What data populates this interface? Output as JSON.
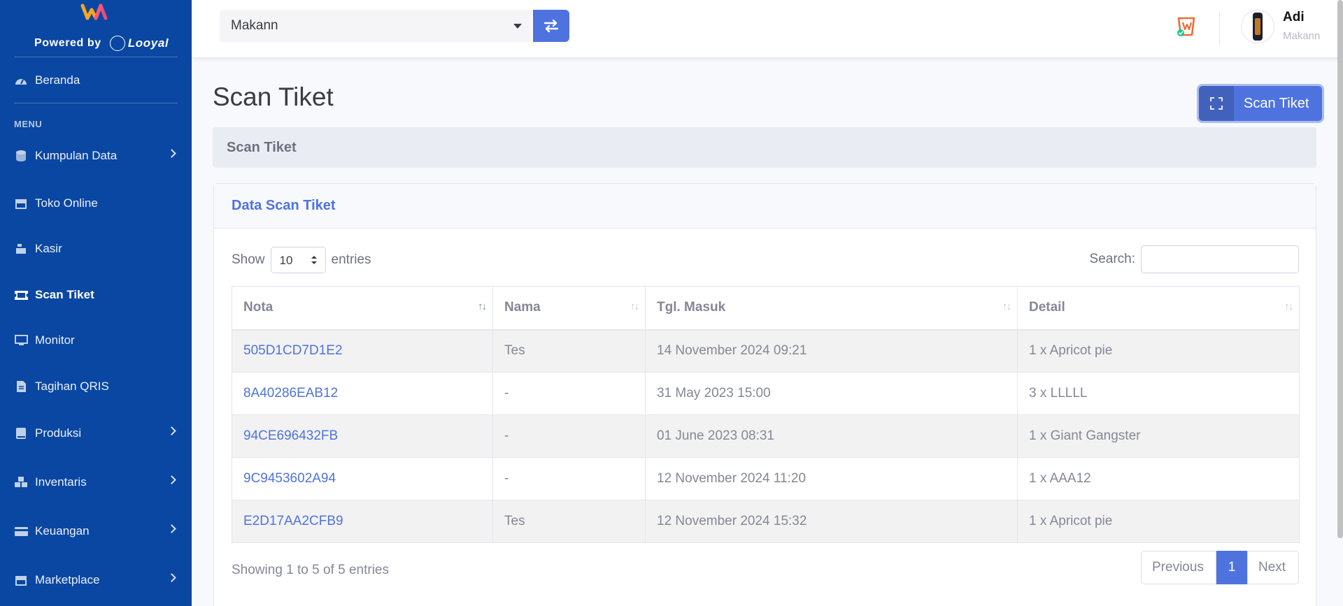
{
  "brand": {
    "powered_by": "Powered by",
    "partner": "Looyal"
  },
  "sidebar": {
    "home": "Beranda",
    "menu_heading": "MENU",
    "items": [
      {
        "label": "Kumpulan Data",
        "icon": "database-icon",
        "has_children": true
      },
      {
        "label": "Toko Online",
        "icon": "store-icon",
        "has_children": false
      },
      {
        "label": "Kasir",
        "icon": "cash-register-icon",
        "has_children": false
      },
      {
        "label": "Scan Tiket",
        "icon": "ticket-icon",
        "has_children": false,
        "active": true
      },
      {
        "label": "Monitor",
        "icon": "desktop-icon",
        "has_children": false
      },
      {
        "label": "Tagihan QRIS",
        "icon": "file-invoice-icon",
        "has_children": false
      },
      {
        "label": "Produksi",
        "icon": "book-icon",
        "has_children": true
      },
      {
        "label": "Inventaris",
        "icon": "cubes-icon",
        "has_children": true
      },
      {
        "label": "Keuangan",
        "icon": "money-icon",
        "has_children": true
      },
      {
        "label": "Marketplace",
        "icon": "shop-icon",
        "has_children": true
      }
    ]
  },
  "topbar": {
    "store_value": "Makann",
    "user_name": "Adi",
    "user_store": "Makann"
  },
  "page": {
    "title": "Scan Tiket",
    "scan_button": "Scan Tiket",
    "breadcrumb": "Scan Tiket"
  },
  "card": {
    "title": "Data Scan Tiket",
    "show_label": "Show",
    "entries_label": "entries",
    "page_length": "10",
    "search_label": "Search:",
    "search_value": "",
    "columns": [
      "Nota",
      "Nama",
      "Tgl. Masuk",
      "Detail"
    ],
    "rows": [
      {
        "nota": "505D1CD7D1E2",
        "nama": "Tes",
        "tgl": "14 November 2024 09:21",
        "detail": "1 x Apricot pie"
      },
      {
        "nota": "8A40286EAB12",
        "nama": "-",
        "tgl": "31 May 2023 15:00",
        "detail": "3 x LLLLL"
      },
      {
        "nota": "94CE696432FB",
        "nama": "-",
        "tgl": "01 June 2023 08:31",
        "detail": "1 x Giant Gangster"
      },
      {
        "nota": "9C9453602A94",
        "nama": "-",
        "tgl": "12 November 2024 11:20",
        "detail": "1 x AAA12"
      },
      {
        "nota": "E2D17AA2CFB9",
        "nama": "Tes",
        "tgl": "12 November 2024 15:32",
        "detail": "1 x Apricot pie"
      }
    ],
    "info": "Showing 1 to 5 of 5 entries",
    "pager": {
      "previous": "Previous",
      "current": "1",
      "next": "Next"
    }
  },
  "colors": {
    "sidebar": "#0a47a3",
    "primary": "#4e73df",
    "background": "#f8f9fc"
  }
}
